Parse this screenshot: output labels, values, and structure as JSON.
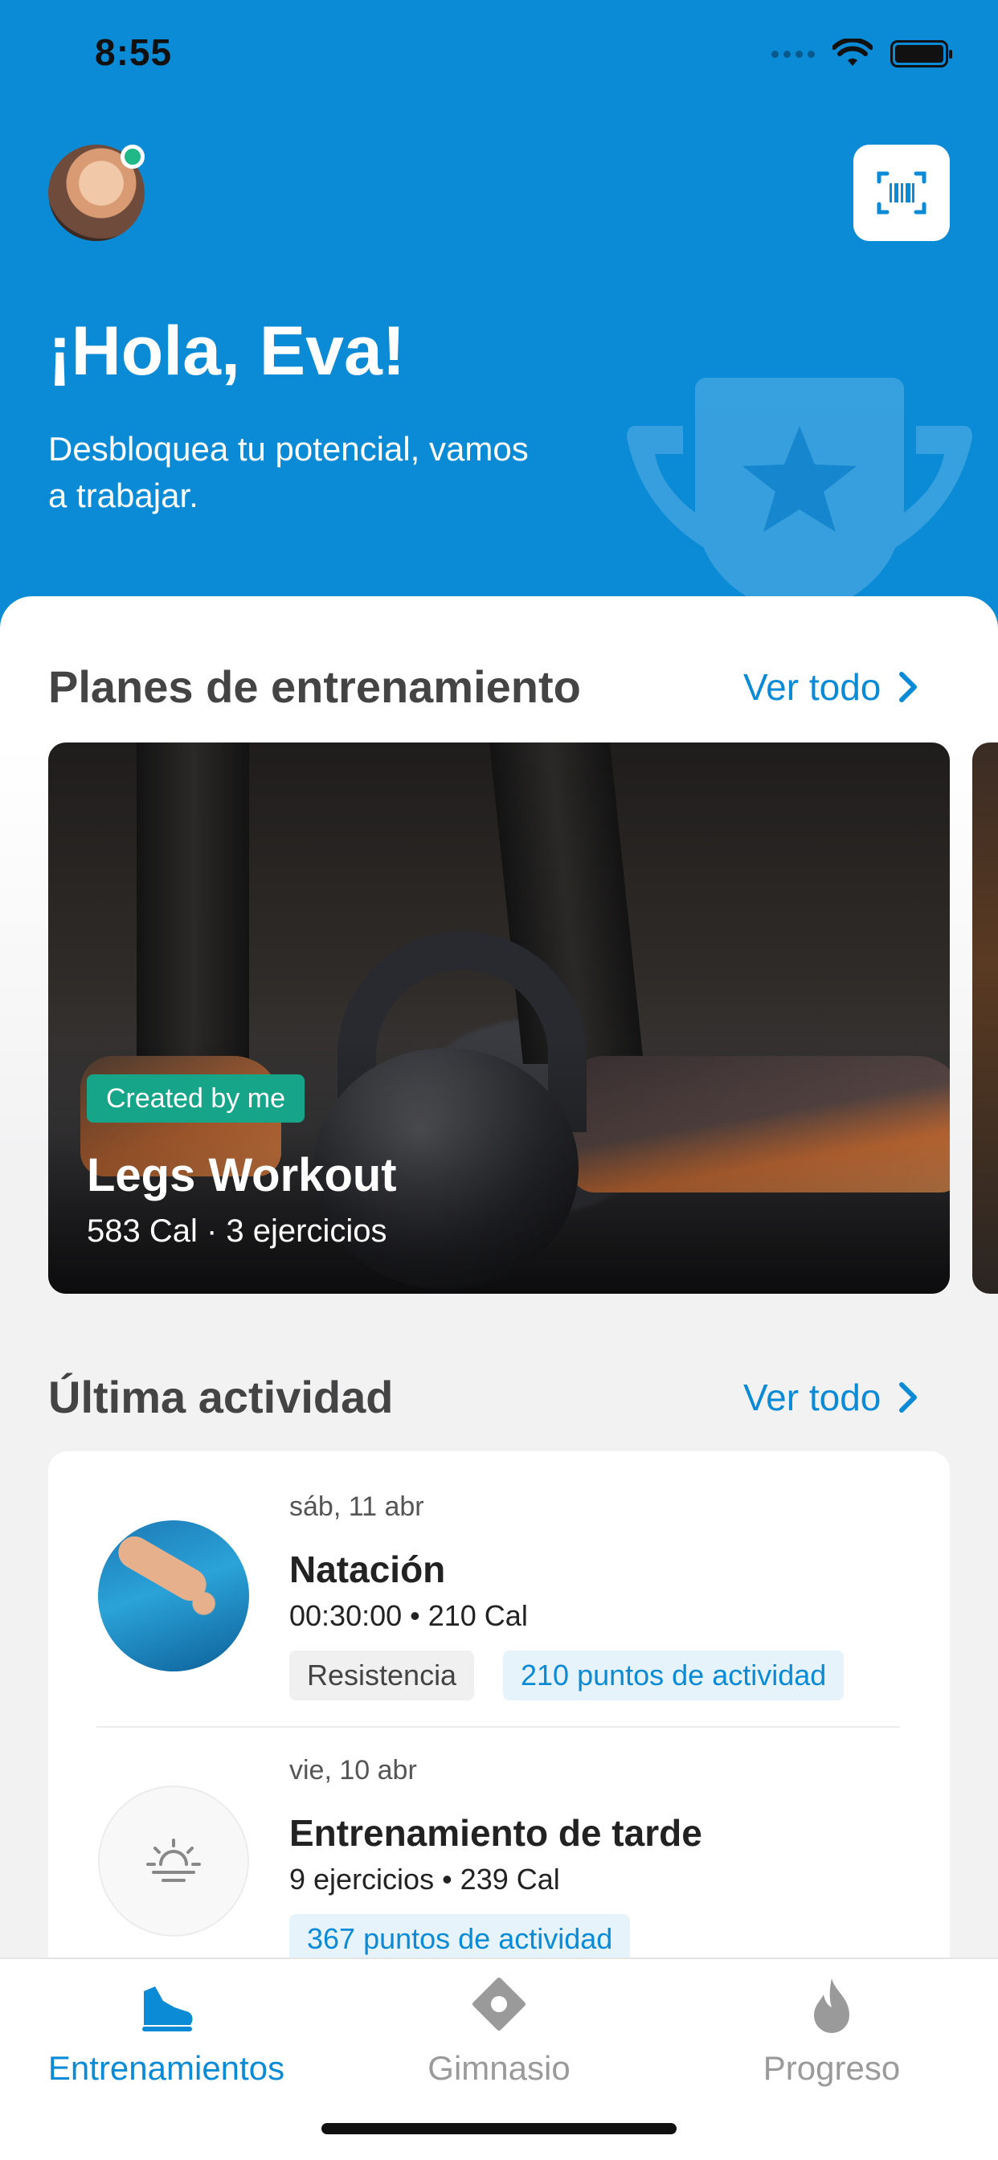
{
  "status_bar": {
    "time": "8:55"
  },
  "colors": {
    "brand": "#0b8bd6",
    "badge_green": "#17a589",
    "online": "#20b887"
  },
  "header": {
    "greeting": "¡Hola, Eva!",
    "subtitle": "Desbloquea tu potencial, vamos a trabajar.",
    "avatar_icon": "user-avatar",
    "scan_icon": "barcode-scan-icon",
    "background_icon": "trophy-icon"
  },
  "plans": {
    "title": "Planes de entrenamiento",
    "see_all": "Ver todo",
    "cards": [
      {
        "badge": "Created by me",
        "name": "Legs Workout",
        "meta": "583 Cal · 3 ejercicios"
      }
    ]
  },
  "activity": {
    "title": "Última actividad",
    "see_all": "Ver todo",
    "items": [
      {
        "date": "sáb, 11 abr",
        "title": "Natación",
        "meta": "00:30:00 • 210 Cal",
        "tags": [
          "Resistencia",
          "210 puntos de actividad"
        ]
      },
      {
        "date": "vie, 10 abr",
        "title": "Entrenamiento de tarde",
        "meta": "9 ejercicios • 239 Cal",
        "tags": [
          "367 puntos de actividad"
        ],
        "icon": "sunset-icon"
      }
    ]
  },
  "tabs": [
    {
      "label": "Entrenamientos",
      "icon": "sneaker-icon",
      "active": true
    },
    {
      "label": "Gimnasio",
      "icon": "location-pin-icon",
      "active": false
    },
    {
      "label": "Progreso",
      "icon": "flame-icon",
      "active": false
    }
  ]
}
